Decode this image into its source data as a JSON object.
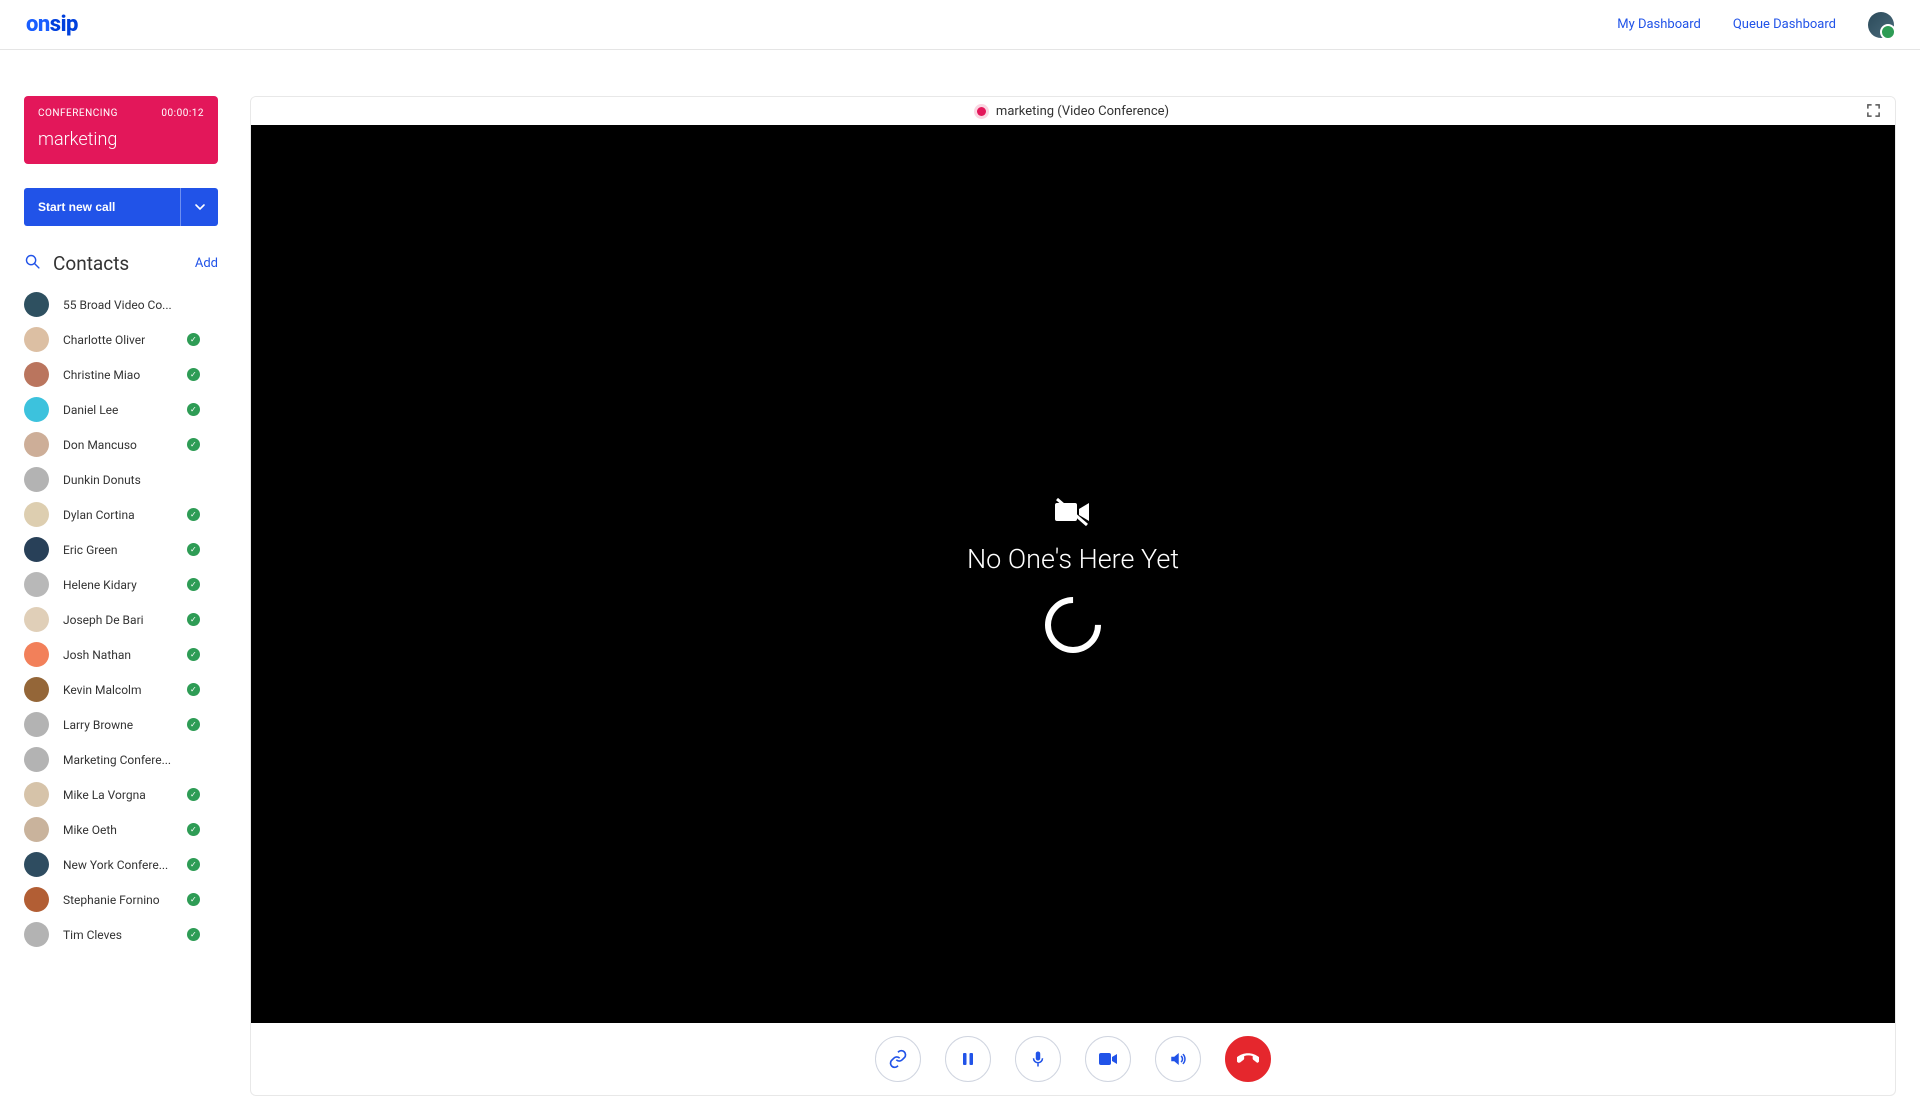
{
  "logo": {
    "left": "on",
    "right": "sip"
  },
  "header": {
    "links": [
      "My Dashboard",
      "Queue Dashboard"
    ]
  },
  "conferencing": {
    "label": "CONFERENCING",
    "time": "00:00:12",
    "name": "marketing"
  },
  "start_call": "Start new call",
  "contacts": {
    "title": "Contacts",
    "add": "Add",
    "items": [
      {
        "name": "55 Broad Video Co...",
        "online": false,
        "hue": 200,
        "sat": 35,
        "lig": 28
      },
      {
        "name": "Charlotte Oliver",
        "online": true,
        "hue": 30,
        "sat": 45,
        "lig": 75
      },
      {
        "name": "Christine Miao",
        "online": true,
        "hue": 15,
        "sat": 40,
        "lig": 55
      },
      {
        "name": "Daniel Lee",
        "online": true,
        "hue": 190,
        "sat": 70,
        "lig": 55
      },
      {
        "name": "Don Mancuso",
        "online": true,
        "hue": 25,
        "sat": 35,
        "lig": 70
      },
      {
        "name": "Dunkin Donuts",
        "online": false,
        "hue": 0,
        "sat": 0,
        "lig": 70
      },
      {
        "name": "Dylan Cortina",
        "online": true,
        "hue": 40,
        "sat": 40,
        "lig": 78
      },
      {
        "name": "Eric Green",
        "online": true,
        "hue": 210,
        "sat": 38,
        "lig": 25
      },
      {
        "name": "Helene Kidary",
        "online": true,
        "hue": 0,
        "sat": 0,
        "lig": 72
      },
      {
        "name": "Joseph De Bari",
        "online": true,
        "hue": 35,
        "sat": 40,
        "lig": 80
      },
      {
        "name": "Josh Nathan",
        "online": true,
        "hue": 15,
        "sat": 85,
        "lig": 65
      },
      {
        "name": "Kevin Malcolm",
        "online": true,
        "hue": 30,
        "sat": 45,
        "lig": 40
      },
      {
        "name": "Larry Browne",
        "online": true,
        "hue": 0,
        "sat": 0,
        "lig": 70
      },
      {
        "name": "Marketing Confere...",
        "online": false,
        "hue": 0,
        "sat": 0,
        "lig": 70
      },
      {
        "name": "Mike La Vorgna",
        "online": true,
        "hue": 35,
        "sat": 35,
        "lig": 75
      },
      {
        "name": "Mike Oeth",
        "online": true,
        "hue": 30,
        "sat": 30,
        "lig": 70
      },
      {
        "name": "New York Confere...",
        "online": true,
        "hue": 205,
        "sat": 35,
        "lig": 28
      },
      {
        "name": "Stephanie Fornino",
        "online": true,
        "hue": 20,
        "sat": 55,
        "lig": 45
      },
      {
        "name": "Tim Cleves",
        "online": true,
        "hue": 0,
        "sat": 0,
        "lig": 70
      }
    ]
  },
  "video": {
    "title": "marketing (Video Conference)",
    "empty_message": "No One's Here Yet"
  },
  "colors": {
    "accent_blue": "#2153e8",
    "accent_pink": "#e3175a",
    "hangup_red": "#e5272d",
    "online_green": "#2e9c55"
  }
}
